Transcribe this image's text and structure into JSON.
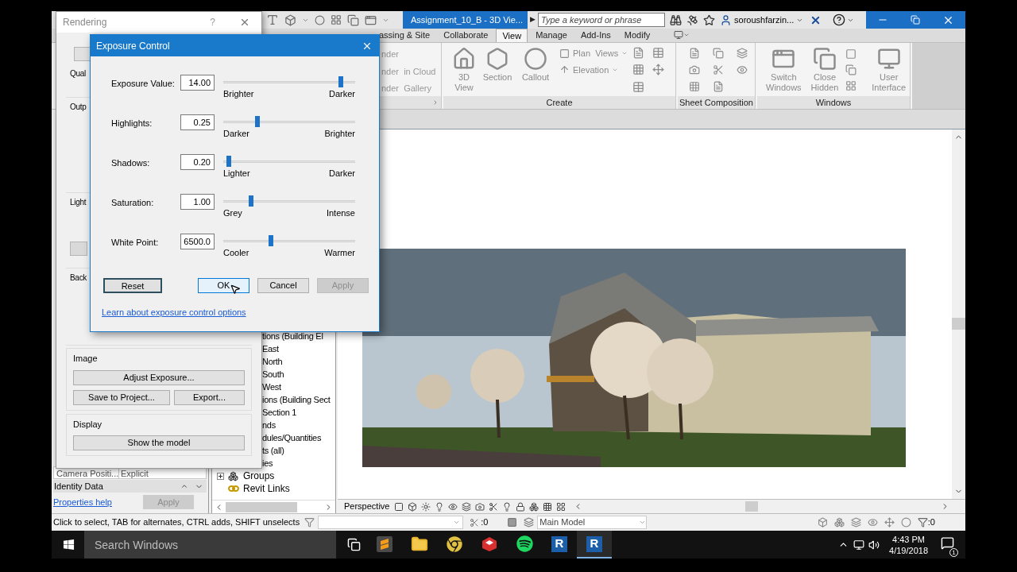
{
  "title_bar": {
    "document_title": "Assignment_10_B - 3D Vie...",
    "tab_arrow": "▶",
    "search": {
      "placeholder": "Type a keyword or phrase"
    },
    "user": "soroushfarzin..."
  },
  "ribbon_tabs": [
    {
      "label": "assing & Site",
      "selected": false
    },
    {
      "label": "Collaborate",
      "selected": false
    },
    {
      "label": "View",
      "selected": true
    },
    {
      "label": "Manage",
      "selected": false
    },
    {
      "label": "Add-Ins",
      "selected": false
    },
    {
      "label": "Modify",
      "selected": false
    }
  ],
  "ribbon_panels": [
    {
      "kind": "render",
      "items": [
        "nder",
        "nder  in Cloud",
        "nder  Gallery"
      ]
    },
    {
      "kind": "create",
      "title": "Create",
      "large": [
        "3D View",
        "Section",
        "Callout"
      ],
      "small": [
        "Plan  Views",
        "Elevation"
      ]
    },
    {
      "kind": "sheets",
      "title": "Sheet Composition"
    },
    {
      "kind": "windows",
      "title": "Windows",
      "large": [
        "Switch Windows",
        "Close Hidden",
        "User Interface"
      ]
    }
  ],
  "properties": {
    "row": {
      "label": "Camera Positi...",
      "value": "Explicit"
    },
    "group": "Identity Data",
    "help_link": "Properties help",
    "apply": {
      "label": "Apply",
      "disabled": true
    }
  },
  "project_browser": {
    "items": [
      {
        "kind": "plain",
        "label": "tions (Building El"
      },
      {
        "kind": "plain",
        "label": "East"
      },
      {
        "kind": "plain",
        "label": "North"
      },
      {
        "kind": "plain",
        "label": "South"
      },
      {
        "kind": "plain",
        "label": "West"
      },
      {
        "kind": "plain",
        "label": "ions (Building Sect"
      },
      {
        "kind": "plain",
        "label": "Section 1"
      },
      {
        "kind": "plain",
        "label": "nds"
      },
      {
        "kind": "plain",
        "label": "dules/Quantities"
      },
      {
        "kind": "plain",
        "label": "ts (all)"
      },
      {
        "kind": "plain",
        "label": "ies"
      },
      {
        "kind": "group",
        "label": "Groups",
        "expanded": false
      },
      {
        "kind": "link",
        "label": "Revit Links"
      }
    ]
  },
  "viewport": {
    "view_name": "Perspective"
  },
  "status_bar": {
    "message": "Click to select, TAB for alternates, CTRL adds, SHIFT unselects",
    "count_left": ":0",
    "model": "Main Model",
    "count_right": ":0"
  },
  "rendering_dialog": {
    "title": "Rendering",
    "help": "?",
    "sections": [
      "Qual",
      "Outp",
      "Light",
      "Back"
    ],
    "image_group": {
      "label": "Image",
      "buttons": [
        "Adjust Exposure...",
        "Save to Project...",
        "Export..."
      ]
    },
    "display_group": {
      "label": "Display",
      "button": "Show the model"
    }
  },
  "exposure_dialog": {
    "title": "Exposure Control",
    "rows": [
      {
        "label": "Exposure Value:",
        "value": "14.00",
        "level": 0.89,
        "min_label": "Brighter",
        "max_label": "Darker"
      },
      {
        "label": "Highlights:",
        "value": "0.25",
        "level": 0.26,
        "min_label": "Darker",
        "max_label": "Brighter"
      },
      {
        "label": "Shadows:",
        "value": "0.20",
        "level": 0.04,
        "min_label": "Lighter",
        "max_label": "Darker"
      },
      {
        "label": "Saturation:",
        "value": "1.00",
        "level": 0.21,
        "min_label": "Grey",
        "max_label": "Intense"
      },
      {
        "label": "White Point:",
        "value": "6500.0",
        "level": 0.36,
        "min_label": "Cooler",
        "max_label": "Warmer"
      }
    ],
    "buttons": [
      {
        "label": "Reset",
        "disabled": false,
        "focused": true,
        "hovered": false
      },
      {
        "label": "OK",
        "disabled": false,
        "focused": false,
        "hovered": true
      },
      {
        "label": "Cancel",
        "disabled": false,
        "focused": false,
        "hovered": false
      },
      {
        "label": "Apply",
        "disabled": true,
        "focused": false,
        "hovered": false
      }
    ],
    "link": "Learn about exposure control options"
  },
  "taskbar": {
    "search": {
      "placeholder": "Search Windows"
    },
    "apps": [
      {
        "kind": "sublime",
        "selected": false
      },
      {
        "kind": "folder",
        "selected": false
      },
      {
        "kind": "chrome",
        "selected": false
      },
      {
        "kind": "sketchup",
        "selected": false
      },
      {
        "kind": "spotify",
        "selected": false
      },
      {
        "kind": "revit",
        "letter": "R",
        "selected": false
      },
      {
        "kind": "revit",
        "letter": "R",
        "selected": true
      }
    ],
    "time": "4:43 PM",
    "date": "4/19/2018",
    "notifications": "1"
  }
}
